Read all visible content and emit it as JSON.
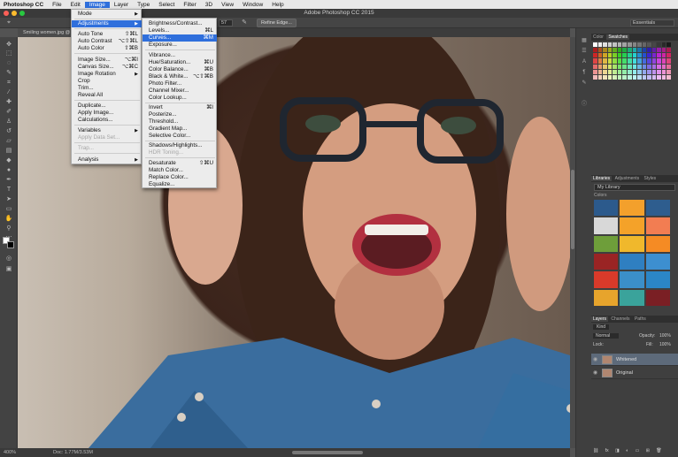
{
  "menubar": {
    "app_name": "Photoshop CC",
    "items": [
      "File",
      "Edit",
      "Image",
      "Layer",
      "Type",
      "Select",
      "Filter",
      "3D",
      "View",
      "Window",
      "Help"
    ]
  },
  "window_title": "Adobe Photoshop CC 2015",
  "options_bar": {
    "value_field": "57",
    "refine_edge": "Refine Edge..."
  },
  "document_tab": "Smiling women.jpg @ ",
  "image_menu": {
    "mode": "Mode",
    "adjustments": "Adjustments",
    "auto_tone": "Auto Tone",
    "auto_tone_sc": "⇧⌘L",
    "auto_contrast": "Auto Contrast",
    "auto_contrast_sc": "⌥⇧⌘L",
    "auto_color": "Auto Color",
    "auto_color_sc": "⇧⌘B",
    "image_size": "Image Size...",
    "image_size_sc": "⌥⌘I",
    "canvas_size": "Canvas Size...",
    "canvas_size_sc": "⌥⌘C",
    "image_rotation": "Image Rotation",
    "crop": "Crop",
    "trim": "Trim...",
    "reveal_all": "Reveal All",
    "duplicate": "Duplicate...",
    "apply_image": "Apply Image...",
    "calculations": "Calculations...",
    "variables": "Variables",
    "apply_data_set": "Apply Data Set...",
    "trap": "Trap...",
    "analysis": "Analysis"
  },
  "adjustments_menu": {
    "brightness_contrast": "Brightness/Contrast...",
    "levels": "Levels...",
    "levels_sc": "⌘L",
    "curves": "Curves...",
    "curves_sc": "⌘M",
    "exposure": "Exposure...",
    "vibrance": "Vibrance...",
    "hue_saturation": "Hue/Saturation...",
    "hue_saturation_sc": "⌘U",
    "color_balance": "Color Balance...",
    "color_balance_sc": "⌘B",
    "black_white": "Black & White...",
    "black_white_sc": "⌥⇧⌘B",
    "photo_filter": "Photo Filter...",
    "channel_mixer": "Channel Mixer...",
    "color_lookup": "Color Lookup...",
    "invert": "Invert",
    "invert_sc": "⌘I",
    "posterize": "Posterize...",
    "threshold": "Threshold...",
    "gradient_map": "Gradient Map...",
    "selective_color": "Selective Color...",
    "shadows_highlights": "Shadows/Highlights...",
    "hdr_toning": "HDR Toning...",
    "desaturate": "Desaturate",
    "desaturate_sc": "⇧⌘U",
    "match_color": "Match Color...",
    "replace_color": "Replace Color...",
    "equalize": "Equalize..."
  },
  "status_bar": {
    "zoom": "400%",
    "doc": "Doc: 1.77M/3.53M"
  },
  "panels": {
    "workspace": "Essentials",
    "color_tabs": [
      "Color",
      "Swatches"
    ],
    "library_tabs": [
      "Libraries",
      "Adjustments",
      "Styles"
    ],
    "library_name": "My Library",
    "library_colors_label": "Colors",
    "layers_tabs": [
      "Layers",
      "Channels",
      "Paths"
    ],
    "kind": "Kind",
    "blend_mode": "Normal",
    "opacity_label": "Opacity:",
    "opacity_value": "100%",
    "lock_label": "Lock:",
    "fill_label": "Fill:",
    "fill_value": "100%",
    "layers": [
      {
        "name": "Whitened"
      },
      {
        "name": "Original"
      }
    ]
  },
  "colors": {
    "accent": "#2f6fdc",
    "library_swatches": [
      "#2c5a8c",
      "#f3a02c",
      "#2e5d8e",
      "#d8d8d8",
      "#f4a229",
      "#f27d52",
      "#6e9e3a",
      "#f0b82c",
      "#f58b24",
      "#9a2424",
      "#2f7fc1",
      "#3d8fd0",
      "#d93a2a",
      "#3b8fc9",
      "#2b86c6",
      "#e7a42c",
      "#3aa39b",
      "#7a1f24"
    ]
  }
}
